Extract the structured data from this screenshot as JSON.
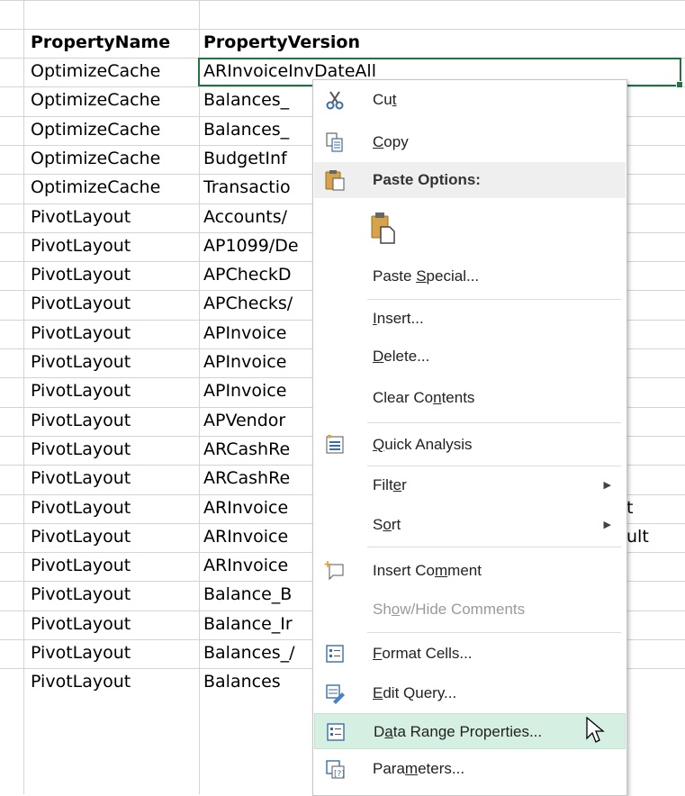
{
  "sheet": {
    "headers": [
      "PropertyName",
      "PropertyVersion"
    ],
    "rows": [
      [
        "OptimizeCache",
        "ARInvoiceInvDateAll"
      ],
      [
        "OptimizeCache",
        "Balances_"
      ],
      [
        "OptimizeCache",
        "Balances_"
      ],
      [
        "OptimizeCache",
        "BudgetInf"
      ],
      [
        "OptimizeCache",
        "Transactio"
      ],
      [
        "PivotLayout",
        "Accounts/"
      ],
      [
        "PivotLayout",
        "AP1099/De"
      ],
      [
        "PivotLayout",
        "APCheckD"
      ],
      [
        "PivotLayout",
        "APChecks/"
      ],
      [
        "PivotLayout",
        "APInvoice"
      ],
      [
        "PivotLayout",
        "APInvoice"
      ],
      [
        "PivotLayout",
        "APInvoice"
      ],
      [
        "PivotLayout",
        "APVendor"
      ],
      [
        "PivotLayout",
        "ARCashRe"
      ],
      [
        "PivotLayout",
        "ARCashRe"
      ],
      [
        "PivotLayout",
        "ARInvoice"
      ],
      [
        "PivotLayout",
        "ARInvoice"
      ],
      [
        "PivotLayout",
        "ARInvoice"
      ],
      [
        "PivotLayout",
        "Balance_B"
      ],
      [
        "PivotLayout",
        "Balance_Ir"
      ],
      [
        "PivotLayout",
        "Balances_/"
      ],
      [
        "PivotLayout",
        "Balances"
      ]
    ],
    "overflow_right": [
      {
        "row": 15,
        "text": "t"
      },
      {
        "row": 16,
        "text": "ult"
      }
    ]
  },
  "context_menu": {
    "cut": {
      "pre": "Cu",
      "ul": "t",
      "post": ""
    },
    "copy": {
      "pre": "",
      "ul": "C",
      "post": "opy"
    },
    "paste_options": "Paste Options:",
    "paste_special": {
      "pre": "Paste ",
      "ul": "S",
      "post": "pecial..."
    },
    "insert": {
      "pre": "",
      "ul": "I",
      "post": "nsert..."
    },
    "delete": {
      "pre": "",
      "ul": "D",
      "post": "elete..."
    },
    "clear_contents": {
      "pre": "Clear Co",
      "ul": "n",
      "post": "tents"
    },
    "quick_analysis": {
      "pre": "",
      "ul": "Q",
      "post": "uick Analysis"
    },
    "filter": {
      "pre": "Filt",
      "ul": "e",
      "post": "r"
    },
    "sort": {
      "pre": "S",
      "ul": "o",
      "post": "rt"
    },
    "insert_comment": {
      "pre": "Insert Co",
      "ul": "m",
      "post": "ment"
    },
    "show_hide_comments": {
      "pre": "Sh",
      "ul": "o",
      "post": "w/Hide Comments"
    },
    "format_cells": {
      "pre": "",
      "ul": "F",
      "post": "ormat Cells..."
    },
    "edit_query": {
      "pre": "",
      "ul": "E",
      "post": "dit Query..."
    },
    "data_range_properties": {
      "pre": "D",
      "ul": "a",
      "post": "ta Range Properties..."
    },
    "parameters": {
      "pre": "Para",
      "ul": "m",
      "post": "eters..."
    }
  },
  "colors": {
    "selection_border": "#217346",
    "menu_hover": "#d5efe2",
    "gridline": "#d4d4d4"
  }
}
